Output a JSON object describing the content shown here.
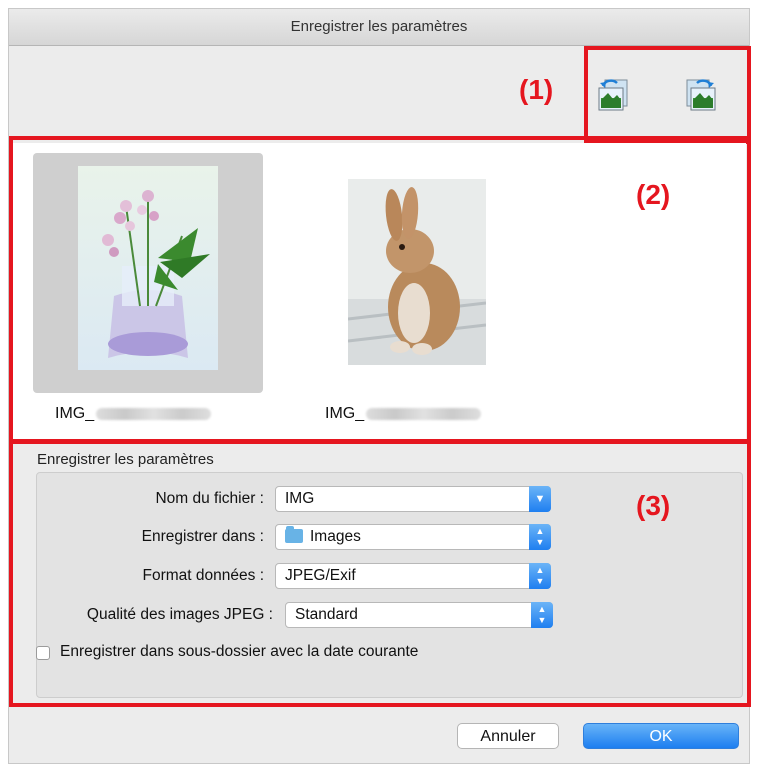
{
  "window": {
    "title": "Enregistrer les paramètres"
  },
  "callouts": {
    "c1": "(1)",
    "c2": "(2)",
    "c3": "(3)"
  },
  "toolbar": {
    "icons": [
      "rotate-left-icon",
      "rotate-right-icon"
    ]
  },
  "gallery": {
    "items": [
      {
        "caption": "IMG_",
        "subject": "flowers-in-vase",
        "selected": true
      },
      {
        "caption": "IMG_",
        "subject": "rabbit",
        "selected": false
      }
    ]
  },
  "settings": {
    "group_title": "Enregistrer les paramètres",
    "file_name_label": "Nom du fichier :",
    "file_name_value": "IMG",
    "save_in_label": "Enregistrer dans :",
    "save_in_value": "Images",
    "format_label": "Format données :",
    "format_value": "JPEG/Exif",
    "quality_label": "Qualité des images JPEG :",
    "quality_value": "Standard",
    "subfolder_checkbox_label": "Enregistrer dans sous-dossier avec la date courante",
    "subfolder_checked": false
  },
  "footer": {
    "cancel_label": "Annuler",
    "ok_label": "OK"
  },
  "colors": {
    "highlight_red": "#e5161f",
    "accent_blue": "#1d7ef0"
  }
}
